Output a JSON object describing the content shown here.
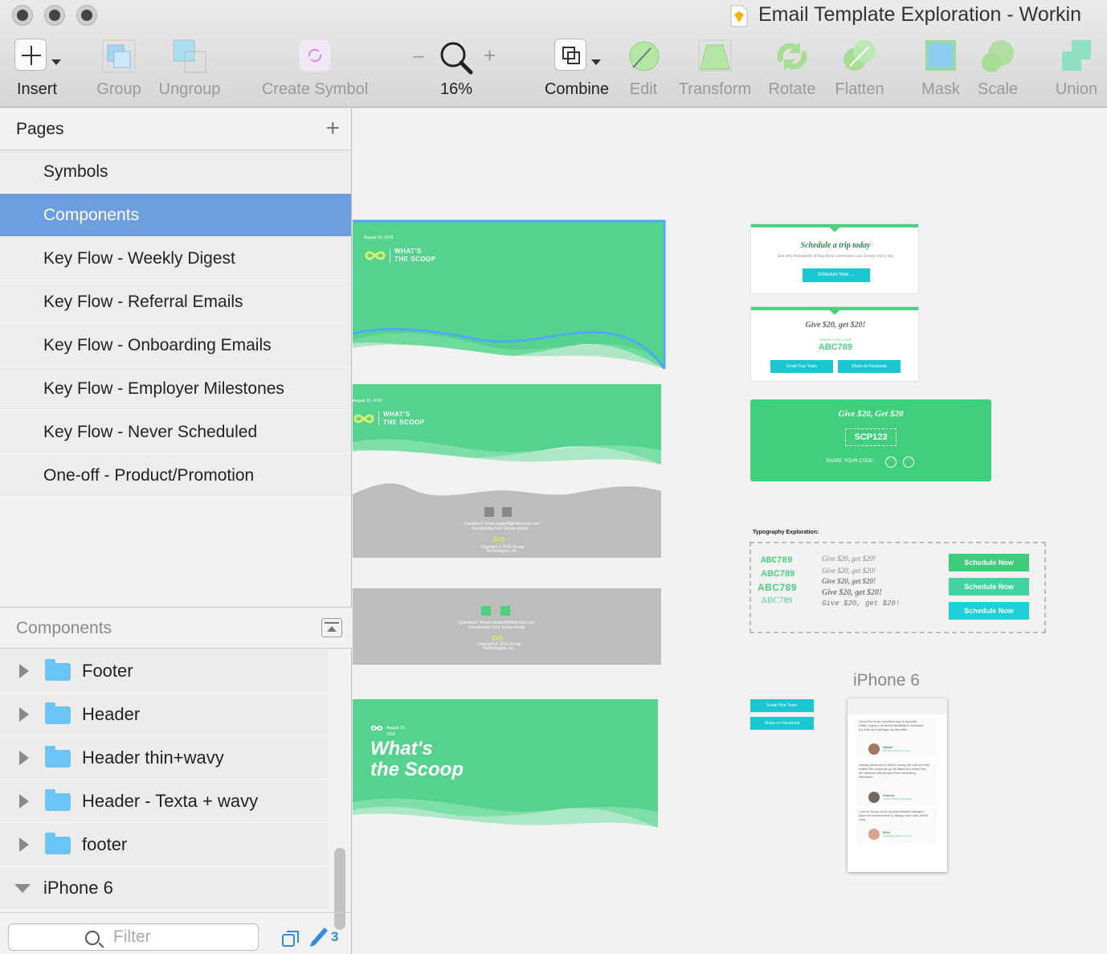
{
  "window": {
    "title": "Email Template Exploration - Workin"
  },
  "toolbar": {
    "insert": "Insert",
    "group": "Group",
    "ungroup": "Ungroup",
    "create_symbol": "Create Symbol",
    "zoom_minus": "–",
    "zoom_plus": "+",
    "zoom": "16%",
    "combine": "Combine",
    "edit": "Edit",
    "transform": "Transform",
    "rotate": "Rotate",
    "flatten": "Flatten",
    "mask": "Mask",
    "scale": "Scale",
    "union": "Union"
  },
  "pages": {
    "title": "Pages",
    "add": "+",
    "items": [
      "Symbols",
      "Components",
      "Key Flow - Weekly Digest",
      "Key Flow - Referral Emails",
      "Key Flow - Onboarding Emails",
      "Key Flow - Employer Milestones",
      "Key Flow - Never Scheduled",
      "One-off - Product/Promotion"
    ],
    "selected": "Components"
  },
  "layers": {
    "title": "Components",
    "items": [
      "Footer",
      "Header",
      "Header thin+wavy",
      "Header - Texta + wavy",
      "footer"
    ],
    "artboard": "iPhone 6"
  },
  "filter": {
    "placeholder": "Filter",
    "count": "3"
  },
  "canvas": {
    "header1": {
      "date": "August 15, 2016",
      "brand_line1": "WHAT'S",
      "brand_line2": "THE SCOOP"
    },
    "header2": {
      "date": "August 15, 2016",
      "brand_line1": "WHAT'S",
      "brand_line2": "THE SCOOP"
    },
    "footer1": {
      "line1": "Questions? Email support@ridescoop.com",
      "line2": "Unsubscribe from Scoop emails",
      "copyright": "Copyright © 2016 Scoop Technologies, Inc."
    },
    "footer2": {
      "line1": "Questions? Email support@ridescoop.com",
      "line2": "Unsubscribe from Scoop emails",
      "copyright": "Copyright © 2016 Scoop Technologies, Inc."
    },
    "header3": {
      "date": "August 15, 2016",
      "title_line1": "What's",
      "title_line2": "the Scoop"
    },
    "schedule_card": {
      "title": "Schedule a trip today",
      "subtitle": "See why thousands of Bay Area commuters use Scoop every day",
      "button": "Schedule Now →"
    },
    "referral_card": {
      "title": "Give $20, get $20!",
      "label": "SHARE YOUR CODE",
      "code": "ABC789",
      "btn_email": "Email Your Team",
      "btn_facebook": "Share on Facebook"
    },
    "green_card": {
      "title": "Give $20, Get $20",
      "code": "SCP123",
      "share": "SHARE YOUR CODE:"
    },
    "typography": {
      "label": "Typography Exploration:",
      "codes": [
        "ABC789",
        "ABC789",
        "ABC789",
        "ABC789"
      ],
      "gives": [
        "Give $20, get $20!",
        "Give $20, get $20!",
        "Give $20, get $20!",
        "Give $20, get $20!",
        "Give $20, get $20!"
      ],
      "buttons": [
        "Schedule Now",
        "Schedule Now",
        "Schedule Now"
      ]
    },
    "small_buttons": {
      "email": "Email Your Team",
      "facebook": "Share on Facebook"
    },
    "iphone": {
      "label": "iPhone 6",
      "testimonials": [
        {
          "text": "I find it to be an excellent way to beat the traffic; it gives me all the flexibility to schedule my trips and manage my favorites.",
          "name": "Natalie",
          "role": "Business Analyst at Cisco"
        },
        {
          "text": "Having someone to talk to during the ride not only makes the commute go by faster but it also lets me network with people from interesting industries.",
          "name": "Anthony",
          "role": "Product Manager at PayPal"
        },
        {
          "text": "I use to Scoop to do my part toward helping to save the environment by taking more cars off the road.",
          "name": "Mark",
          "role": "Marketing Manager at Intuit"
        }
      ]
    }
  },
  "colors": {
    "brand_green": "#55d28d",
    "selection_blue": "#6f9ee0",
    "teal": "#1ac6cf",
    "footer_gray": "#bdbdbd"
  }
}
